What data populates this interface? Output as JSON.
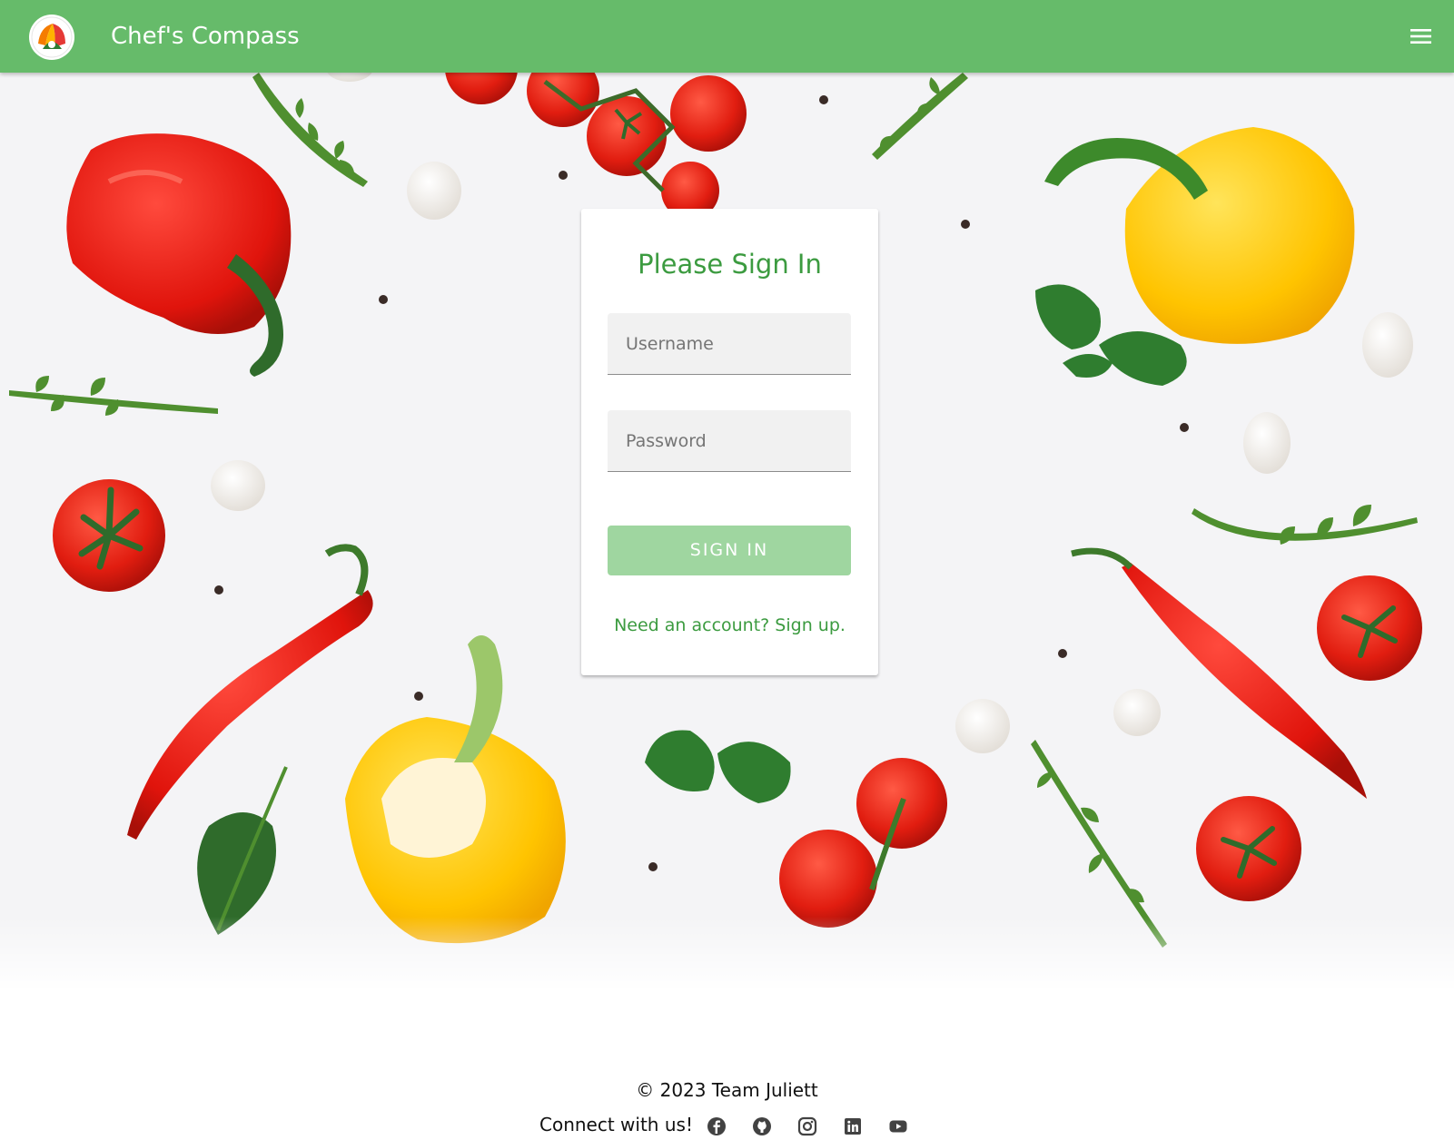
{
  "navbar": {
    "brand": "Chef's Compass",
    "logo_icon": "chefs-compass-logo",
    "menu_icon": "hamburger-menu-icon",
    "bg_color": "#66bb6a"
  },
  "signin_card": {
    "title": "Please Sign In",
    "username_placeholder": "Username",
    "password_placeholder": "Password",
    "submit_label": "SIGN IN",
    "signup_link": "Need an account? Sign up."
  },
  "footer": {
    "copyright": "© 2023 Team Juliett",
    "connect_label": "Connect with us!",
    "social_icons": [
      "facebook-icon",
      "github-icon",
      "instagram-icon",
      "linkedin-icon",
      "youtube-icon"
    ]
  },
  "colors": {
    "accent_green": "#3c9b40",
    "button_green_disabled": "#9fd6a0",
    "hero_bg": "#f4f4f6"
  }
}
